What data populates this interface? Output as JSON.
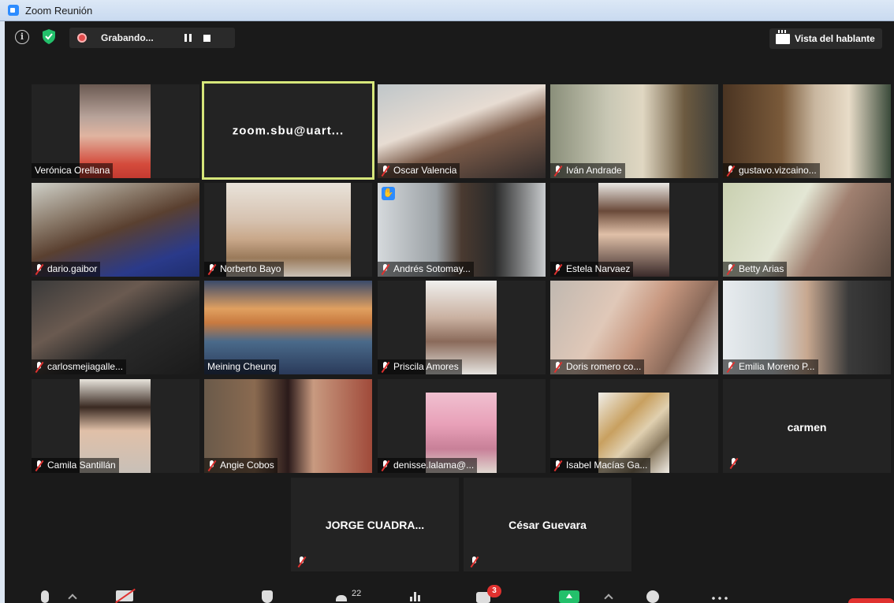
{
  "window": {
    "title": "Zoom Reunión"
  },
  "topbar": {
    "recording_label": "Grabando...",
    "speaker_view_label": "Vista del hablante"
  },
  "participants": [
    {
      "name": "Verónica Orellana",
      "muted": false
    },
    {
      "name": "zoom.sbu@uart...",
      "muted": false,
      "no_video": true,
      "active": true
    },
    {
      "name": "Oscar Valencia",
      "muted": true
    },
    {
      "name": "Iván Andrade",
      "muted": true
    },
    {
      "name": "gustavo.vizcaino...",
      "muted": true
    },
    {
      "name": "dario.gaibor",
      "muted": true
    },
    {
      "name": "Norberto Bayo",
      "muted": true
    },
    {
      "name": "Andrés Sotomay...",
      "muted": true,
      "hand_raised": true
    },
    {
      "name": "Estela Narvaez",
      "muted": true
    },
    {
      "name": "Betty Arias",
      "muted": true
    },
    {
      "name": "carlosmejiagalle...",
      "muted": true
    },
    {
      "name": "Meining Cheung",
      "muted": false
    },
    {
      "name": "Priscila Amores",
      "muted": true
    },
    {
      "name": "Doris romero co...",
      "muted": true
    },
    {
      "name": "Emilia Moreno P...",
      "muted": true
    },
    {
      "name": "Camila Santillán",
      "muted": true
    },
    {
      "name": "Angie Cobos",
      "muted": true
    },
    {
      "name": "denisse.lalama@...",
      "muted": true
    },
    {
      "name": "Isabel Macías Ga...",
      "muted": true
    },
    {
      "name": "carmen",
      "muted": true,
      "no_video": true
    },
    {
      "name": "JORGE CUADRA...",
      "muted": true,
      "no_video": true
    },
    {
      "name": "César Guevara",
      "muted": true,
      "no_video": true
    }
  ],
  "toolbar": {
    "participant_count": "22",
    "chat_badge": "3"
  },
  "icons": [
    "info-icon",
    "shield-icon",
    "record-icon",
    "pause-icon",
    "stop-icon",
    "grid-icon",
    "mic-icon",
    "video-off-icon",
    "security-icon",
    "participants-icon",
    "poll-icon",
    "chat-icon",
    "share-icon",
    "reactions-icon",
    "more-icon",
    "raised-hand-icon",
    "muted-mic-icon"
  ],
  "colors": {
    "active_speaker": "#d6e67a",
    "record": "#e24c4c",
    "share": "#23c06b",
    "hand": "#2d8cff",
    "muted": "#e0312f"
  }
}
